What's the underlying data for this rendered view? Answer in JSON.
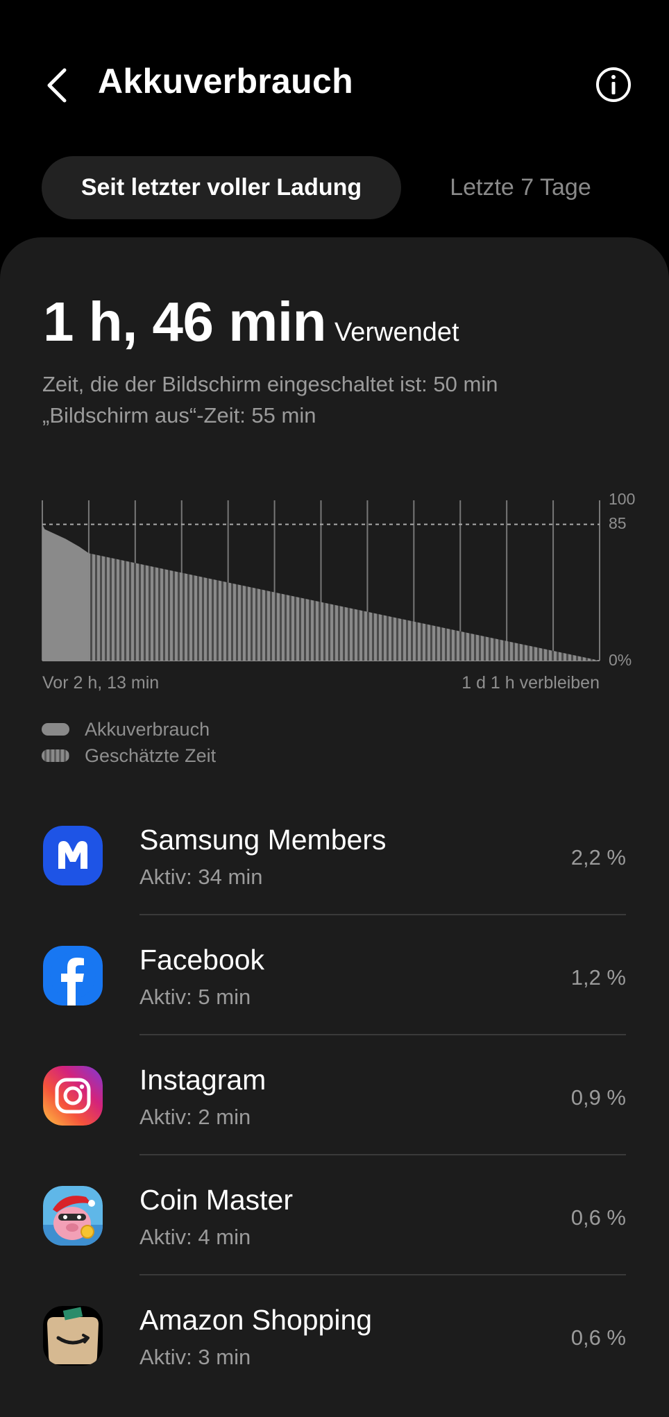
{
  "header": {
    "title": "Akkuverbrauch"
  },
  "tabs": [
    {
      "label": "Seit letzter voller Ladung",
      "active": true
    },
    {
      "label": "Letzte 7 Tage",
      "active": false
    }
  ],
  "summary": {
    "used_time": "1 h, 46 min",
    "used_label": "Verwendet",
    "screen_on": "Zeit, die der Bildschirm eingeschaltet ist: 50 min",
    "screen_off": "„Bildschirm aus“-Zeit: 55 min"
  },
  "chart": {
    "start_label": "Vor 2 h, 13 min",
    "end_label": "1 d 1 h verbleiben",
    "y_labels": {
      "top": "100",
      "line": "85",
      "bottom": "0%"
    }
  },
  "chart_data": {
    "type": "area",
    "title": "",
    "xlabel": "",
    "ylabel": "",
    "ylim": [
      0,
      100
    ],
    "reference_line": 85,
    "series": [
      {
        "name": "Akkuverbrauch",
        "style": "solid",
        "points": [
          {
            "x": 0,
            "y": 85
          },
          {
            "x": 0.05,
            "y": 82
          },
          {
            "x": 0.2,
            "y": 80
          },
          {
            "x": 0.5,
            "y": 76
          },
          {
            "x": 0.8,
            "y": 71
          },
          {
            "x": 1.0,
            "y": 67
          }
        ]
      },
      {
        "name": "Geschätzte Zeit",
        "style": "striped",
        "points": [
          {
            "x": 1.0,
            "y": 67
          },
          {
            "x": 12.0,
            "y": 0
          }
        ]
      }
    ]
  },
  "legend": [
    {
      "label": "Akkuverbrauch",
      "style": "solid"
    },
    {
      "label": "Geschätzte Zeit",
      "style": "striped"
    }
  ],
  "apps": [
    {
      "name": "Samsung Members",
      "active": "Aktiv: 34 min",
      "percent": "2,2 %",
      "icon": "samsung-members-icon"
    },
    {
      "name": "Facebook",
      "active": "Aktiv: 5 min",
      "percent": "1,2 %",
      "icon": "facebook-icon"
    },
    {
      "name": "Instagram",
      "active": "Aktiv: 2 min",
      "percent": "0,9 %",
      "icon": "instagram-icon"
    },
    {
      "name": "Coin Master",
      "active": "Aktiv: 4 min",
      "percent": "0,6 %",
      "icon": "coin-master-icon"
    },
    {
      "name": "Amazon Shopping",
      "active": "Aktiv: 3 min",
      "percent": "0,6 %",
      "icon": "amazon-shopping-icon"
    }
  ],
  "colors": {
    "background": "#000000",
    "card": "#1c1c1c",
    "tab_active": "#222222",
    "chart_fill": "#8a8a8a",
    "secondary_text": "#9b9b9b"
  }
}
